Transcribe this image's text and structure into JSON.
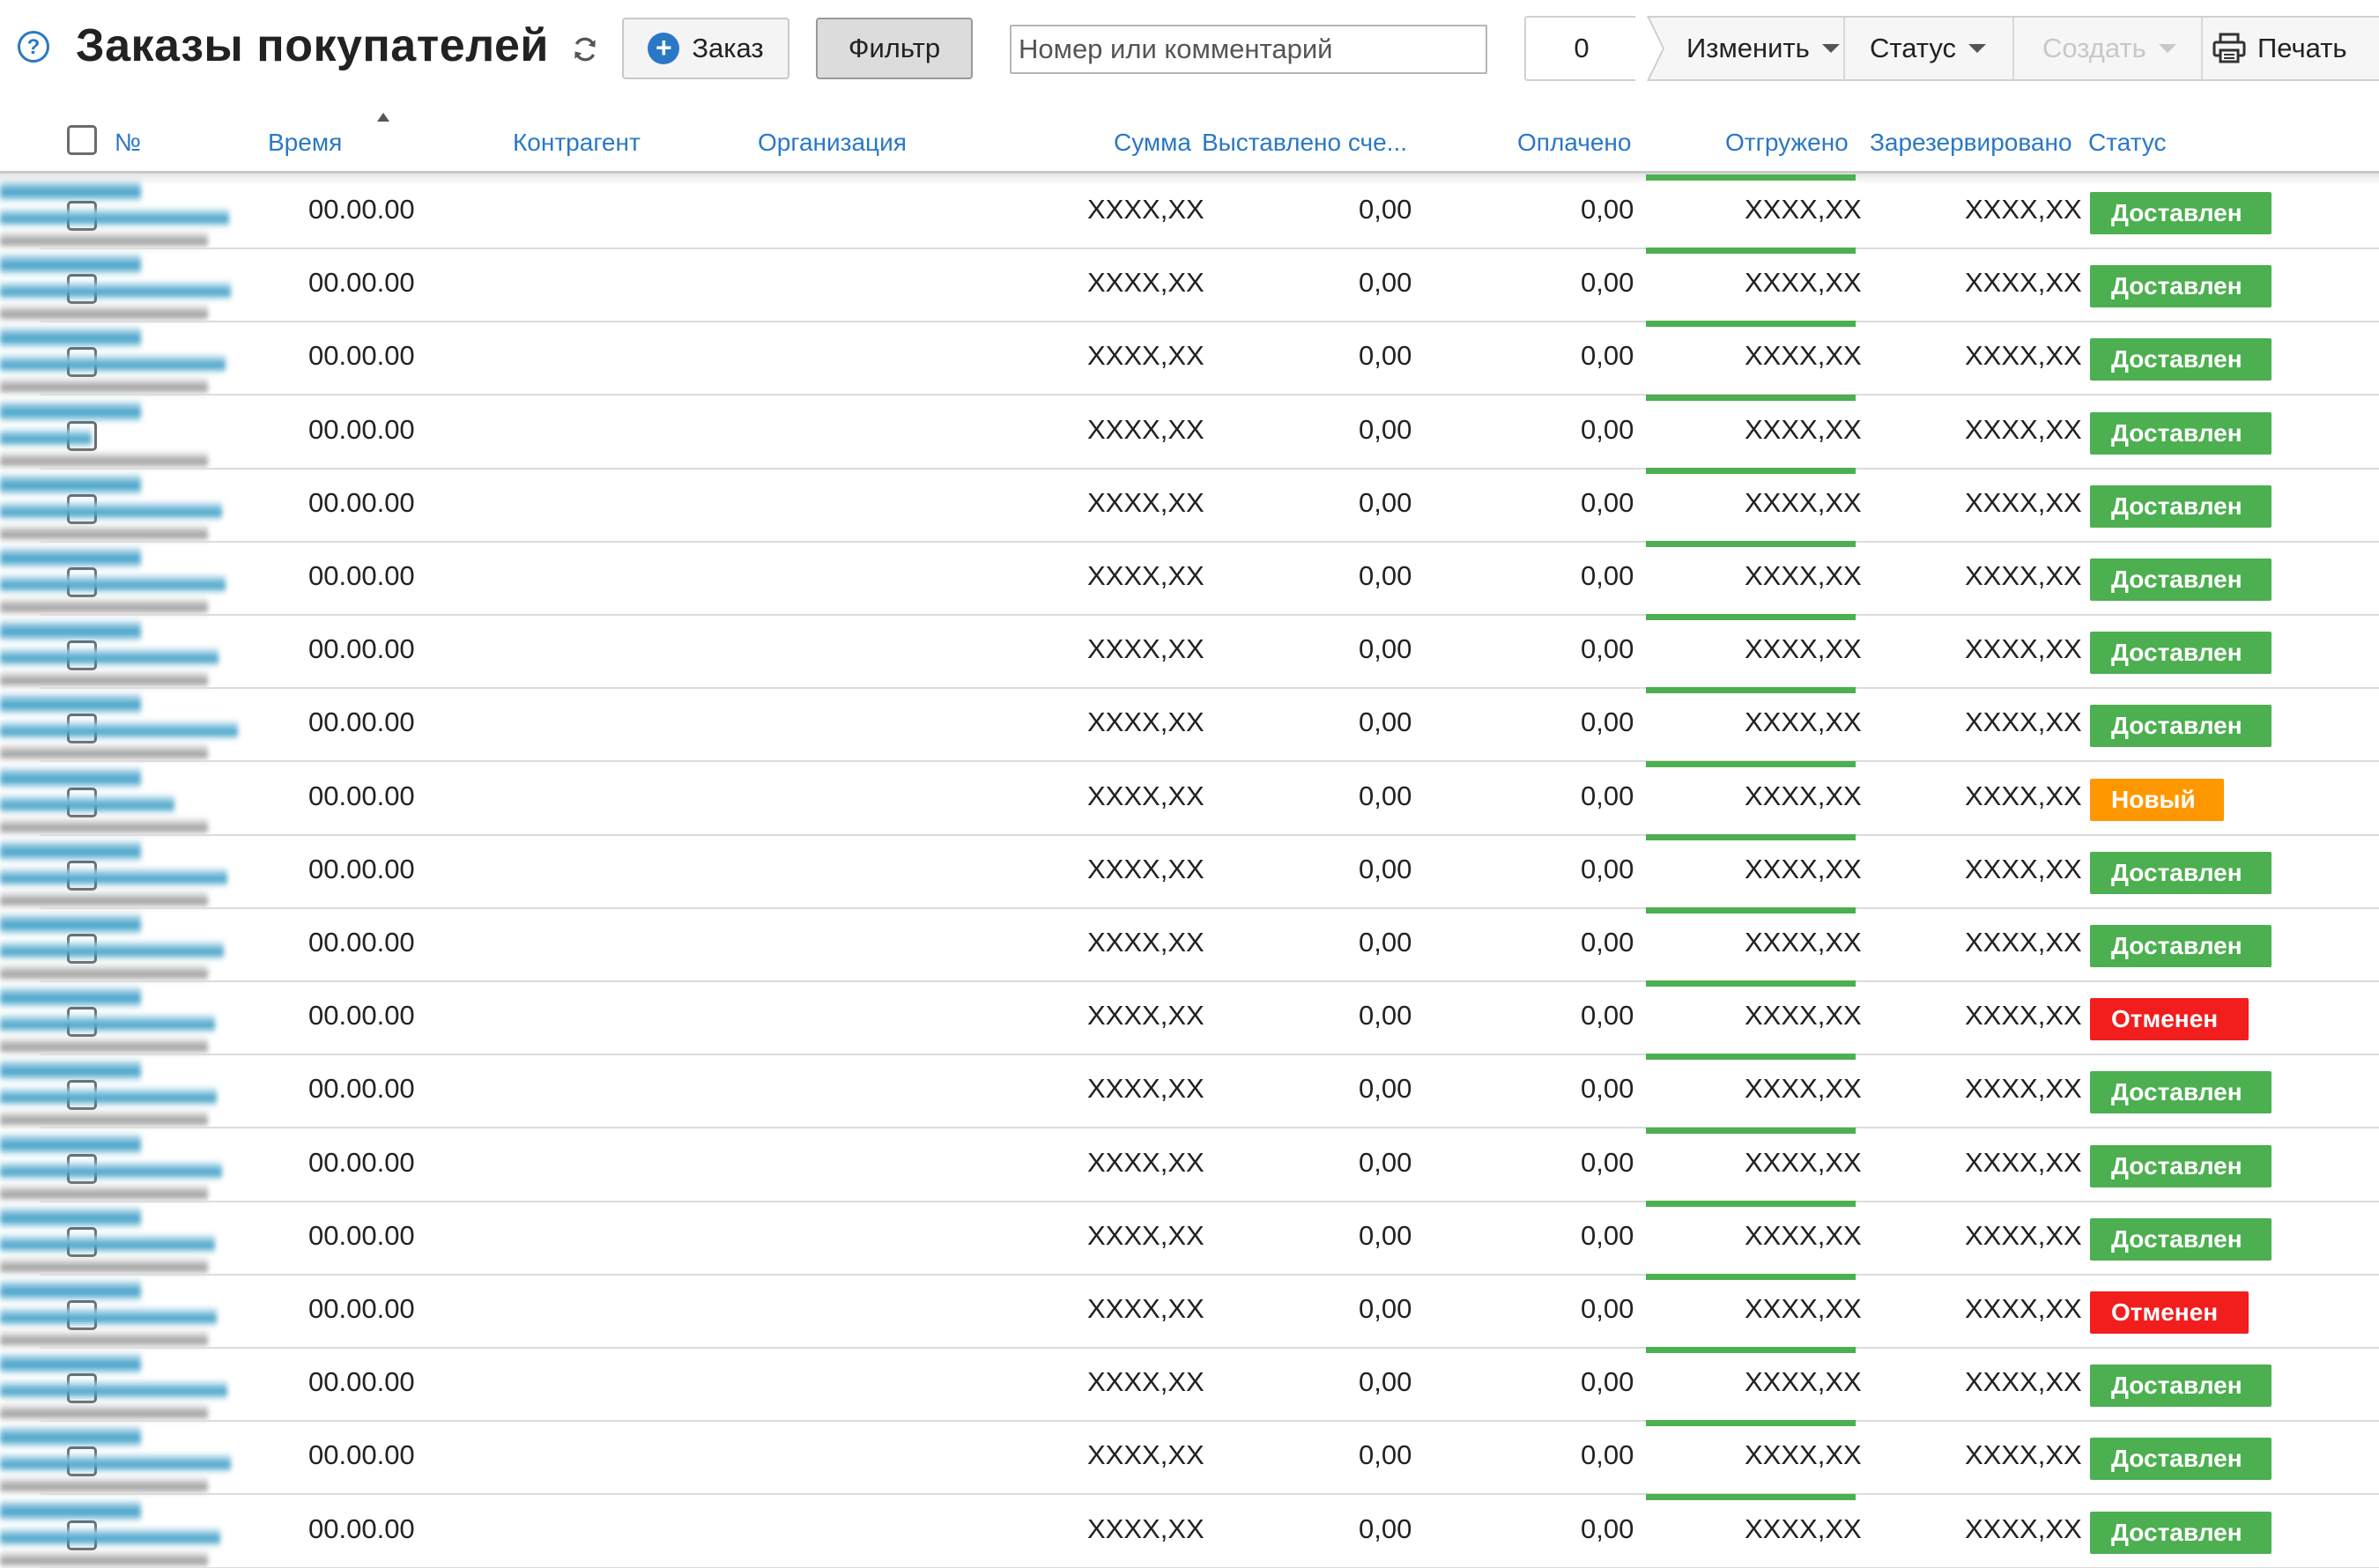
{
  "header": {
    "title": "Заказы покупателей",
    "order_button": "Заказ",
    "filter_button": "Фильтр",
    "search_placeholder": "Номер или комментарий",
    "selected_count": "0",
    "change_button": "Изменить",
    "status_button": "Статус",
    "create_button": "Создать",
    "print_button": "Печать"
  },
  "table": {
    "columns": {
      "num": "№",
      "time": "Время",
      "contractor": "Контрагент",
      "organization": "Организация",
      "sum": "Сумма",
      "invoiced": "Выставлено сче...",
      "paid": "Оплачено",
      "shipped": "Отгружено",
      "reserved": "Зарезервировано",
      "status": "Статус"
    },
    "rows": [
      {
        "time": "00.00.00",
        "sum": "XXXX,XX",
        "invoiced": "0,00",
        "paid": "0,00",
        "shipped": "XXXX,XX",
        "reserved": "XXXX,XX",
        "status": "Доставлен"
      },
      {
        "time": "00.00.00",
        "sum": "XXXX,XX",
        "invoiced": "0,00",
        "paid": "0,00",
        "shipped": "XXXX,XX",
        "reserved": "XXXX,XX",
        "status": "Доставлен"
      },
      {
        "time": "00.00.00",
        "sum": "XXXX,XX",
        "invoiced": "0,00",
        "paid": "0,00",
        "shipped": "XXXX,XX",
        "reserved": "XXXX,XX",
        "status": "Доставлен"
      },
      {
        "time": "00.00.00",
        "sum": "XXXX,XX",
        "invoiced": "0,00",
        "paid": "0,00",
        "shipped": "XXXX,XX",
        "reserved": "XXXX,XX",
        "status": "Доставлен"
      },
      {
        "time": "00.00.00",
        "sum": "XXXX,XX",
        "invoiced": "0,00",
        "paid": "0,00",
        "shipped": "XXXX,XX",
        "reserved": "XXXX,XX",
        "status": "Доставлен"
      },
      {
        "time": "00.00.00",
        "sum": "XXXX,XX",
        "invoiced": "0,00",
        "paid": "0,00",
        "shipped": "XXXX,XX",
        "reserved": "XXXX,XX",
        "status": "Доставлен"
      },
      {
        "time": "00.00.00",
        "sum": "XXXX,XX",
        "invoiced": "0,00",
        "paid": "0,00",
        "shipped": "XXXX,XX",
        "reserved": "XXXX,XX",
        "status": "Доставлен"
      },
      {
        "time": "00.00.00",
        "sum": "XXXX,XX",
        "invoiced": "0,00",
        "paid": "0,00",
        "shipped": "XXXX,XX",
        "reserved": "XXXX,XX",
        "status": "Доставлен"
      },
      {
        "time": "00.00.00",
        "sum": "XXXX,XX",
        "invoiced": "0,00",
        "paid": "0,00",
        "shipped": "XXXX,XX",
        "reserved": "XXXX,XX",
        "status": "Новый"
      },
      {
        "time": "00.00.00",
        "sum": "XXXX,XX",
        "invoiced": "0,00",
        "paid": "0,00",
        "shipped": "XXXX,XX",
        "reserved": "XXXX,XX",
        "status": "Доставлен"
      },
      {
        "time": "00.00.00",
        "sum": "XXXX,XX",
        "invoiced": "0,00",
        "paid": "0,00",
        "shipped": "XXXX,XX",
        "reserved": "XXXX,XX",
        "status": "Доставлен"
      },
      {
        "time": "00.00.00",
        "sum": "XXXX,XX",
        "invoiced": "0,00",
        "paid": "0,00",
        "shipped": "XXXX,XX",
        "reserved": "XXXX,XX",
        "status": "Отменен"
      },
      {
        "time": "00.00.00",
        "sum": "XXXX,XX",
        "invoiced": "0,00",
        "paid": "0,00",
        "shipped": "XXXX,XX",
        "reserved": "XXXX,XX",
        "status": "Доставлен"
      },
      {
        "time": "00.00.00",
        "sum": "XXXX,XX",
        "invoiced": "0,00",
        "paid": "0,00",
        "shipped": "XXXX,XX",
        "reserved": "XXXX,XX",
        "status": "Доставлен"
      },
      {
        "time": "00.00.00",
        "sum": "XXXX,XX",
        "invoiced": "0,00",
        "paid": "0,00",
        "shipped": "XXXX,XX",
        "reserved": "XXXX,XX",
        "status": "Доставлен"
      },
      {
        "time": "00.00.00",
        "sum": "XXXX,XX",
        "invoiced": "0,00",
        "paid": "0,00",
        "shipped": "XXXX,XX",
        "reserved": "XXXX,XX",
        "status": "Отменен"
      },
      {
        "time": "00.00.00",
        "sum": "XXXX,XX",
        "invoiced": "0,00",
        "paid": "0,00",
        "shipped": "XXXX,XX",
        "reserved": "XXXX,XX",
        "status": "Доставлен"
      },
      {
        "time": "00.00.00",
        "sum": "XXXX,XX",
        "invoiced": "0,00",
        "paid": "0,00",
        "shipped": "XXXX,XX",
        "reserved": "XXXX,XX",
        "status": "Доставлен"
      },
      {
        "time": "00.00.00",
        "sum": "XXXX,XX",
        "invoiced": "0,00",
        "paid": "0,00",
        "shipped": "XXXX,XX",
        "reserved": "XXXX,XX",
        "status": "Доставлен"
      }
    ]
  },
  "status_colors": {
    "Доставлен": "#4caf50",
    "Новый": "#ff9800",
    "Отменен": "#f21d1d"
  },
  "icons": {
    "help": "help-icon",
    "refresh": "refresh-icon",
    "add": "plus-icon",
    "print": "printer-icon"
  }
}
